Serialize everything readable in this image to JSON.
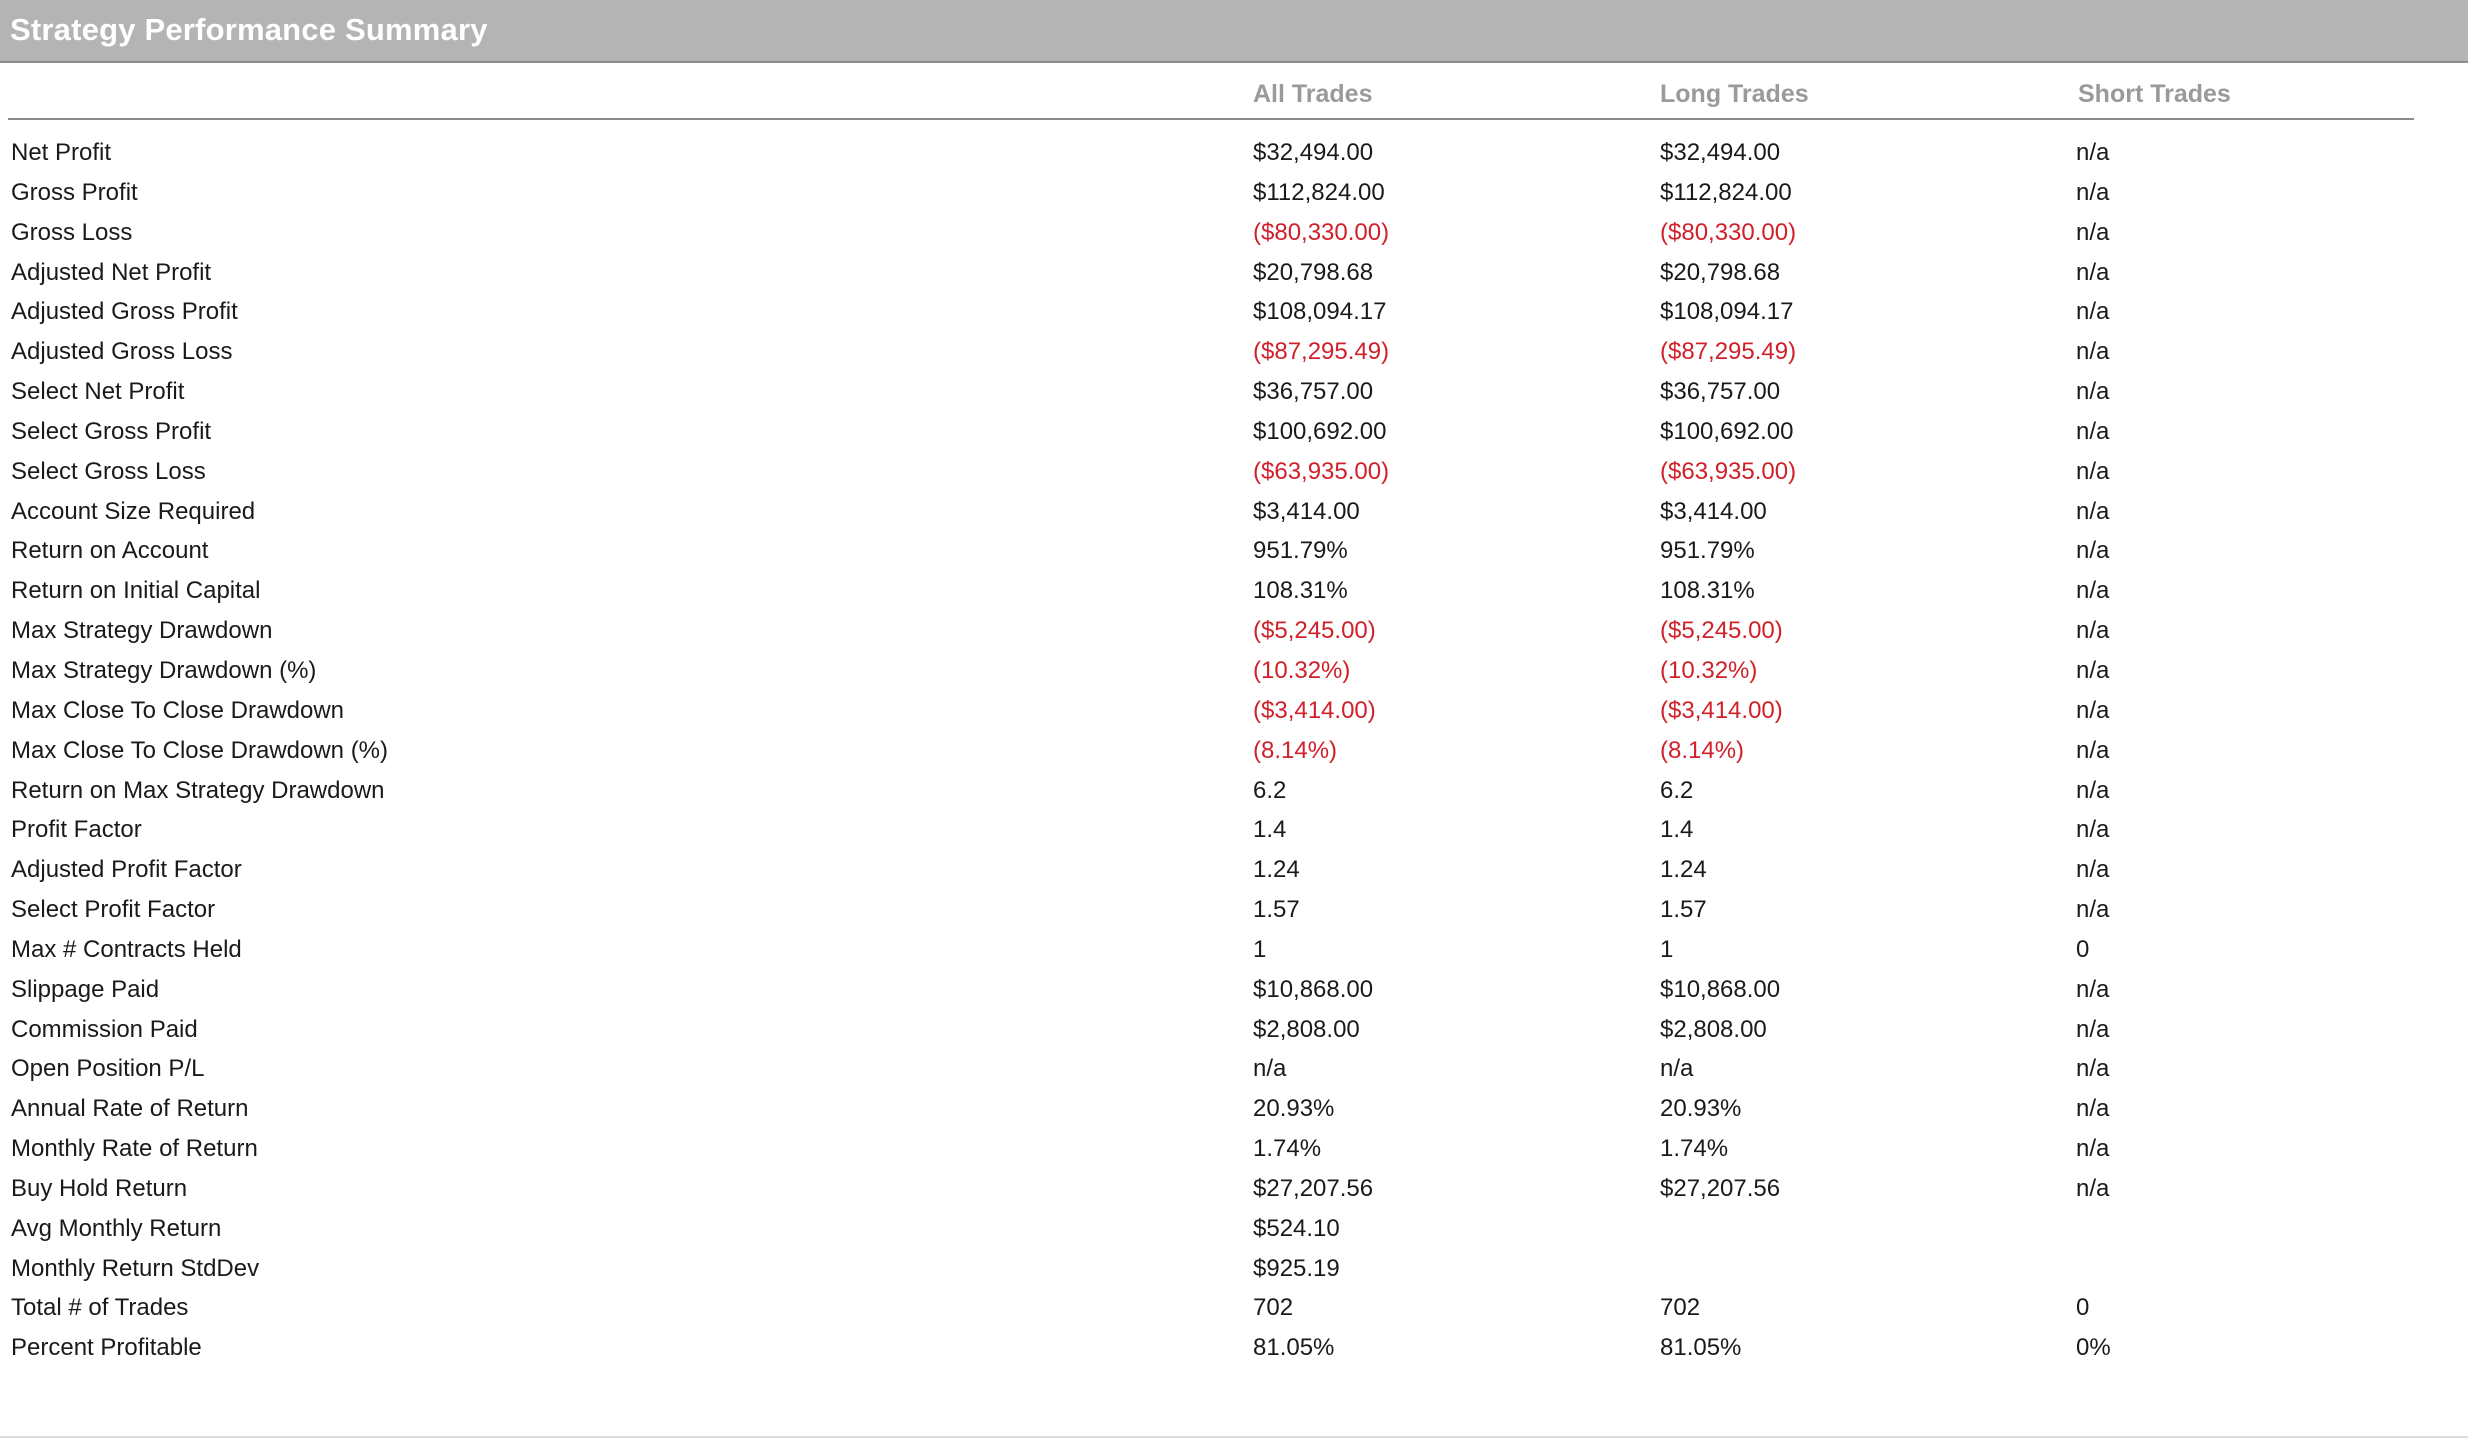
{
  "window": {
    "title": "Strategy Performance Summary"
  },
  "columns": {
    "label": "",
    "all": "All Trades",
    "long": "Long Trades",
    "short": "Short Trades"
  },
  "rows": [
    {
      "label": "Net Profit",
      "all": "$32,494.00",
      "long": "$32,494.00",
      "short": "n/a"
    },
    {
      "label": "Gross Profit",
      "all": "$112,824.00",
      "long": "$112,824.00",
      "short": "n/a"
    },
    {
      "label": "Gross Loss",
      "all": "($80,330.00)",
      "long": "($80,330.00)",
      "short": "n/a"
    },
    {
      "label": "Adjusted Net Profit",
      "all": "$20,798.68",
      "long": "$20,798.68",
      "short": "n/a"
    },
    {
      "label": "Adjusted Gross Profit",
      "all": "$108,094.17",
      "long": "$108,094.17",
      "short": "n/a"
    },
    {
      "label": "Adjusted Gross Loss",
      "all": "($87,295.49)",
      "long": "($87,295.49)",
      "short": "n/a"
    },
    {
      "label": "Select Net Profit",
      "all": "$36,757.00",
      "long": "$36,757.00",
      "short": "n/a"
    },
    {
      "label": "Select Gross Profit",
      "all": "$100,692.00",
      "long": "$100,692.00",
      "short": "n/a"
    },
    {
      "label": "Select Gross Loss",
      "all": "($63,935.00)",
      "long": "($63,935.00)",
      "short": "n/a"
    },
    {
      "label": "Account Size Required",
      "all": "$3,414.00",
      "long": "$3,414.00",
      "short": "n/a"
    },
    {
      "label": "Return on Account",
      "all": "951.79%",
      "long": "951.79%",
      "short": "n/a"
    },
    {
      "label": "Return on Initial Capital",
      "all": "108.31%",
      "long": "108.31%",
      "short": "n/a"
    },
    {
      "label": "Max Strategy Drawdown",
      "all": "($5,245.00)",
      "long": "($5,245.00)",
      "short": "n/a"
    },
    {
      "label": "Max Strategy Drawdown (%)",
      "all": "(10.32%)",
      "long": "(10.32%)",
      "short": "n/a"
    },
    {
      "label": "Max Close To Close Drawdown",
      "all": "($3,414.00)",
      "long": "($3,414.00)",
      "short": "n/a"
    },
    {
      "label": "Max Close To Close Drawdown (%)",
      "all": "(8.14%)",
      "long": "(8.14%)",
      "short": "n/a"
    },
    {
      "label": "Return on Max Strategy Drawdown",
      "all": "6.2",
      "long": "6.2",
      "short": "n/a"
    },
    {
      "label": "Profit Factor",
      "all": "1.4",
      "long": "1.4",
      "short": "n/a"
    },
    {
      "label": "Adjusted Profit Factor",
      "all": "1.24",
      "long": "1.24",
      "short": "n/a"
    },
    {
      "label": "Select Profit Factor",
      "all": "1.57",
      "long": "1.57",
      "short": "n/a"
    },
    {
      "label": "Max # Contracts Held",
      "all": "1",
      "long": "1",
      "short": "0"
    },
    {
      "label": "Slippage Paid",
      "all": "$10,868.00",
      "long": "$10,868.00",
      "short": "n/a"
    },
    {
      "label": "Commission Paid",
      "all": "$2,808.00",
      "long": "$2,808.00",
      "short": "n/a"
    },
    {
      "label": "Open Position P/L",
      "all": "n/a",
      "long": "n/a",
      "short": "n/a"
    },
    {
      "label": "Annual Rate of Return",
      "all": "20.93%",
      "long": "20.93%",
      "short": "n/a"
    },
    {
      "label": "Monthly Rate of Return",
      "all": "1.74%",
      "long": "1.74%",
      "short": "n/a"
    },
    {
      "label": "Buy  Hold Return",
      "all": "$27,207.56",
      "long": "$27,207.56",
      "short": "n/a"
    },
    {
      "label": "Avg Monthly Return",
      "all": "$524.10",
      "long": "",
      "short": ""
    },
    {
      "label": "Monthly Return StdDev",
      "all": "$925.19",
      "long": "",
      "short": ""
    },
    {
      "label": "Total # of Trades",
      "all": "702",
      "long": "702",
      "short": "0"
    },
    {
      "label": "Percent Profitable",
      "all": "81.05%",
      "long": "81.05%",
      "short": "0%"
    }
  ],
  "colors": {
    "titlebar_bg": "#b4b4b4",
    "header_text": "#9a9a9a",
    "negative_text": "#d0202a",
    "body_text": "#1a1a1a"
  }
}
